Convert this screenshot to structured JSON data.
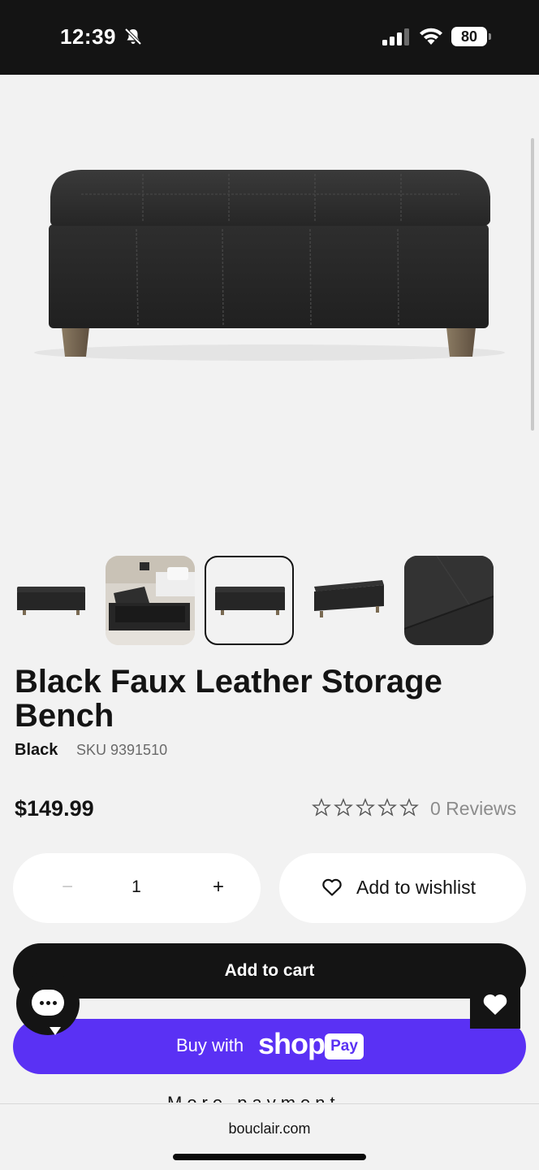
{
  "status_bar": {
    "time": "12:39",
    "battery": "80",
    "icons": [
      "bell-slash-icon",
      "signal-icon",
      "wifi-icon",
      "battery-icon"
    ]
  },
  "product": {
    "title": "Black Faux Leather Storage Bench",
    "variant": "Black",
    "sku": "SKU 9391510",
    "price": "$149.99",
    "rating_stars": 0,
    "rating_max": 5,
    "reviews": "0 Reviews",
    "images": [
      "bench-front",
      "bench-open-lifestyle",
      "bench-front",
      "bench-open-angle",
      "leather-detail"
    ],
    "selected_image": 3
  },
  "quantity": {
    "minus": "−",
    "value": "1",
    "plus": "+"
  },
  "actions": {
    "wishlist": "Add to wishlist",
    "add_to_cart": "Add to cart",
    "buy_with": "Buy with",
    "shop_brand": "shop",
    "pay_badge": "Pay"
  },
  "browser": {
    "url": "bouclair.com"
  },
  "colors": {
    "dark": "#141414",
    "shop_pay": "#5a31f4",
    "background": "#f2f2f2"
  }
}
